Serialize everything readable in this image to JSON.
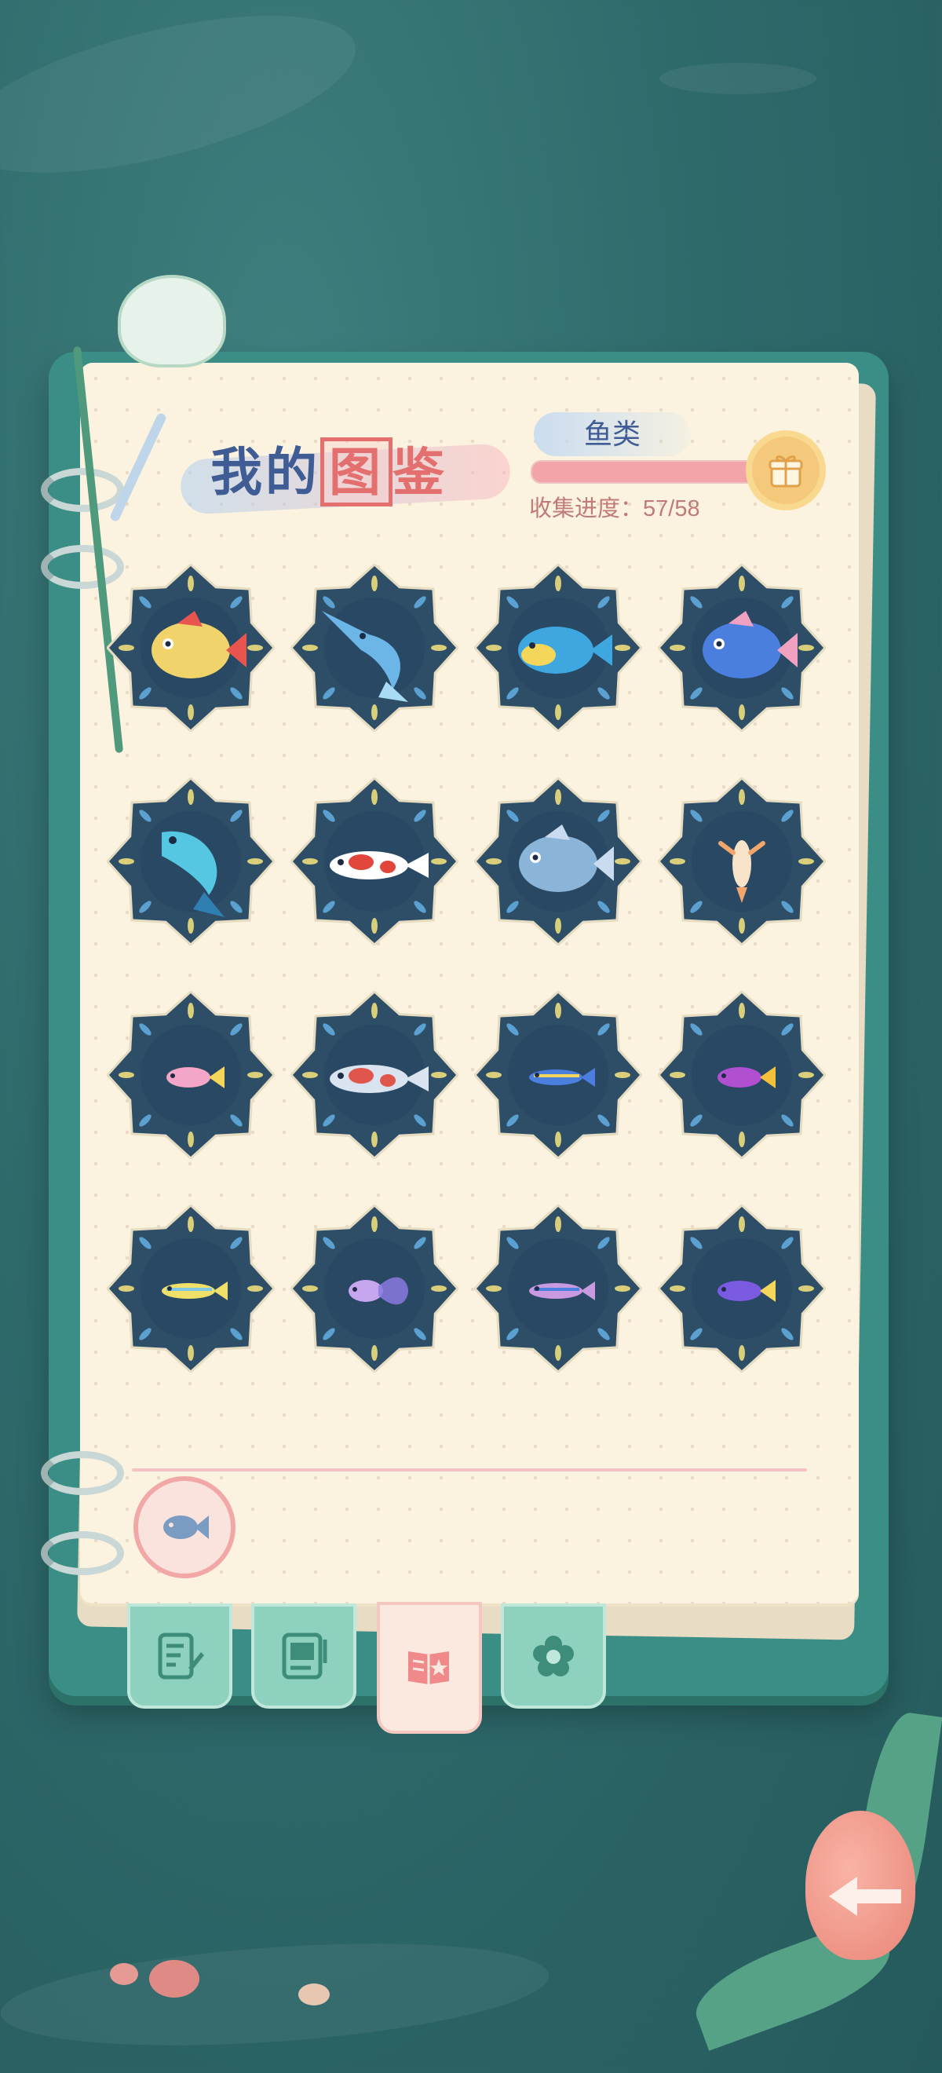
{
  "header": {
    "title_part1": "我的",
    "title_boxed": "图",
    "title_part3": "鉴",
    "category": "鱼类",
    "progress_label": "收集进度：",
    "progress_value": "57/58",
    "progress_fraction": 0.983
  },
  "collection": {
    "items": [
      {
        "name": "opah-fish",
        "body": "#f0d36a",
        "accent": "#e8554f",
        "shape": "round"
      },
      {
        "name": "swordfish",
        "body": "#6bb6e6",
        "accent": "#a8dcf5",
        "shape": "sword"
      },
      {
        "name": "parrotfish",
        "body": "#3fa7e0",
        "accent": "#f3d65a",
        "shape": "oval"
      },
      {
        "name": "pufferfish",
        "body": "#4a7fe0",
        "accent": "#f0a0c0",
        "shape": "round"
      },
      {
        "name": "yellowfin-tuna",
        "body": "#55c7e3",
        "accent": "#2f7fb3",
        "shape": "leap"
      },
      {
        "name": "koi",
        "body": "#ffffff",
        "accent": "#e0463c",
        "shape": "long"
      },
      {
        "name": "moonfish",
        "body": "#8ab4d8",
        "accent": "#c9dcef",
        "shape": "round"
      },
      {
        "name": "sea-angel",
        "body": "#f6e3c8",
        "accent": "#f3a66b",
        "shape": "tiny"
      },
      {
        "name": "guppy",
        "body": "#f3a6c8",
        "accent": "#f3d65a",
        "shape": "small"
      },
      {
        "name": "red-tail-fish",
        "body": "#d9e4f0",
        "accent": "#e0554c",
        "shape": "long"
      },
      {
        "name": "blue-tang",
        "body": "#4a7fe0",
        "accent": "#f3d65a",
        "shape": "slim"
      },
      {
        "name": "royal-gramma",
        "body": "#b04fd0",
        "accent": "#f3c03a",
        "shape": "small"
      },
      {
        "name": "yellow-tetra",
        "body": "#f0e06a",
        "accent": "#7fc7e3",
        "shape": "slim"
      },
      {
        "name": "betta",
        "body": "#c7a6f0",
        "accent": "#8a7ae0",
        "shape": "fan"
      },
      {
        "name": "neon-tetra",
        "body": "#c99ae0",
        "accent": "#4a7fe0",
        "shape": "slim"
      },
      {
        "name": "purple-dottyback",
        "body": "#7a5ae0",
        "accent": "#f3d65a",
        "shape": "small"
      }
    ]
  },
  "tabs": [
    {
      "name": "tab-notes",
      "icon": "notepad-pencil-icon"
    },
    {
      "name": "tab-album",
      "icon": "photo-document-icon"
    },
    {
      "name": "tab-collection",
      "icon": "book-star-icon"
    },
    {
      "name": "tab-flower",
      "icon": "flower-icon"
    }
  ],
  "colors": {
    "background": "#2f6a6b",
    "page": "#fbf3df",
    "frame": "#2d4e66",
    "accent_pink": "#f3a4a8",
    "title_blue": "#3f5c94"
  }
}
